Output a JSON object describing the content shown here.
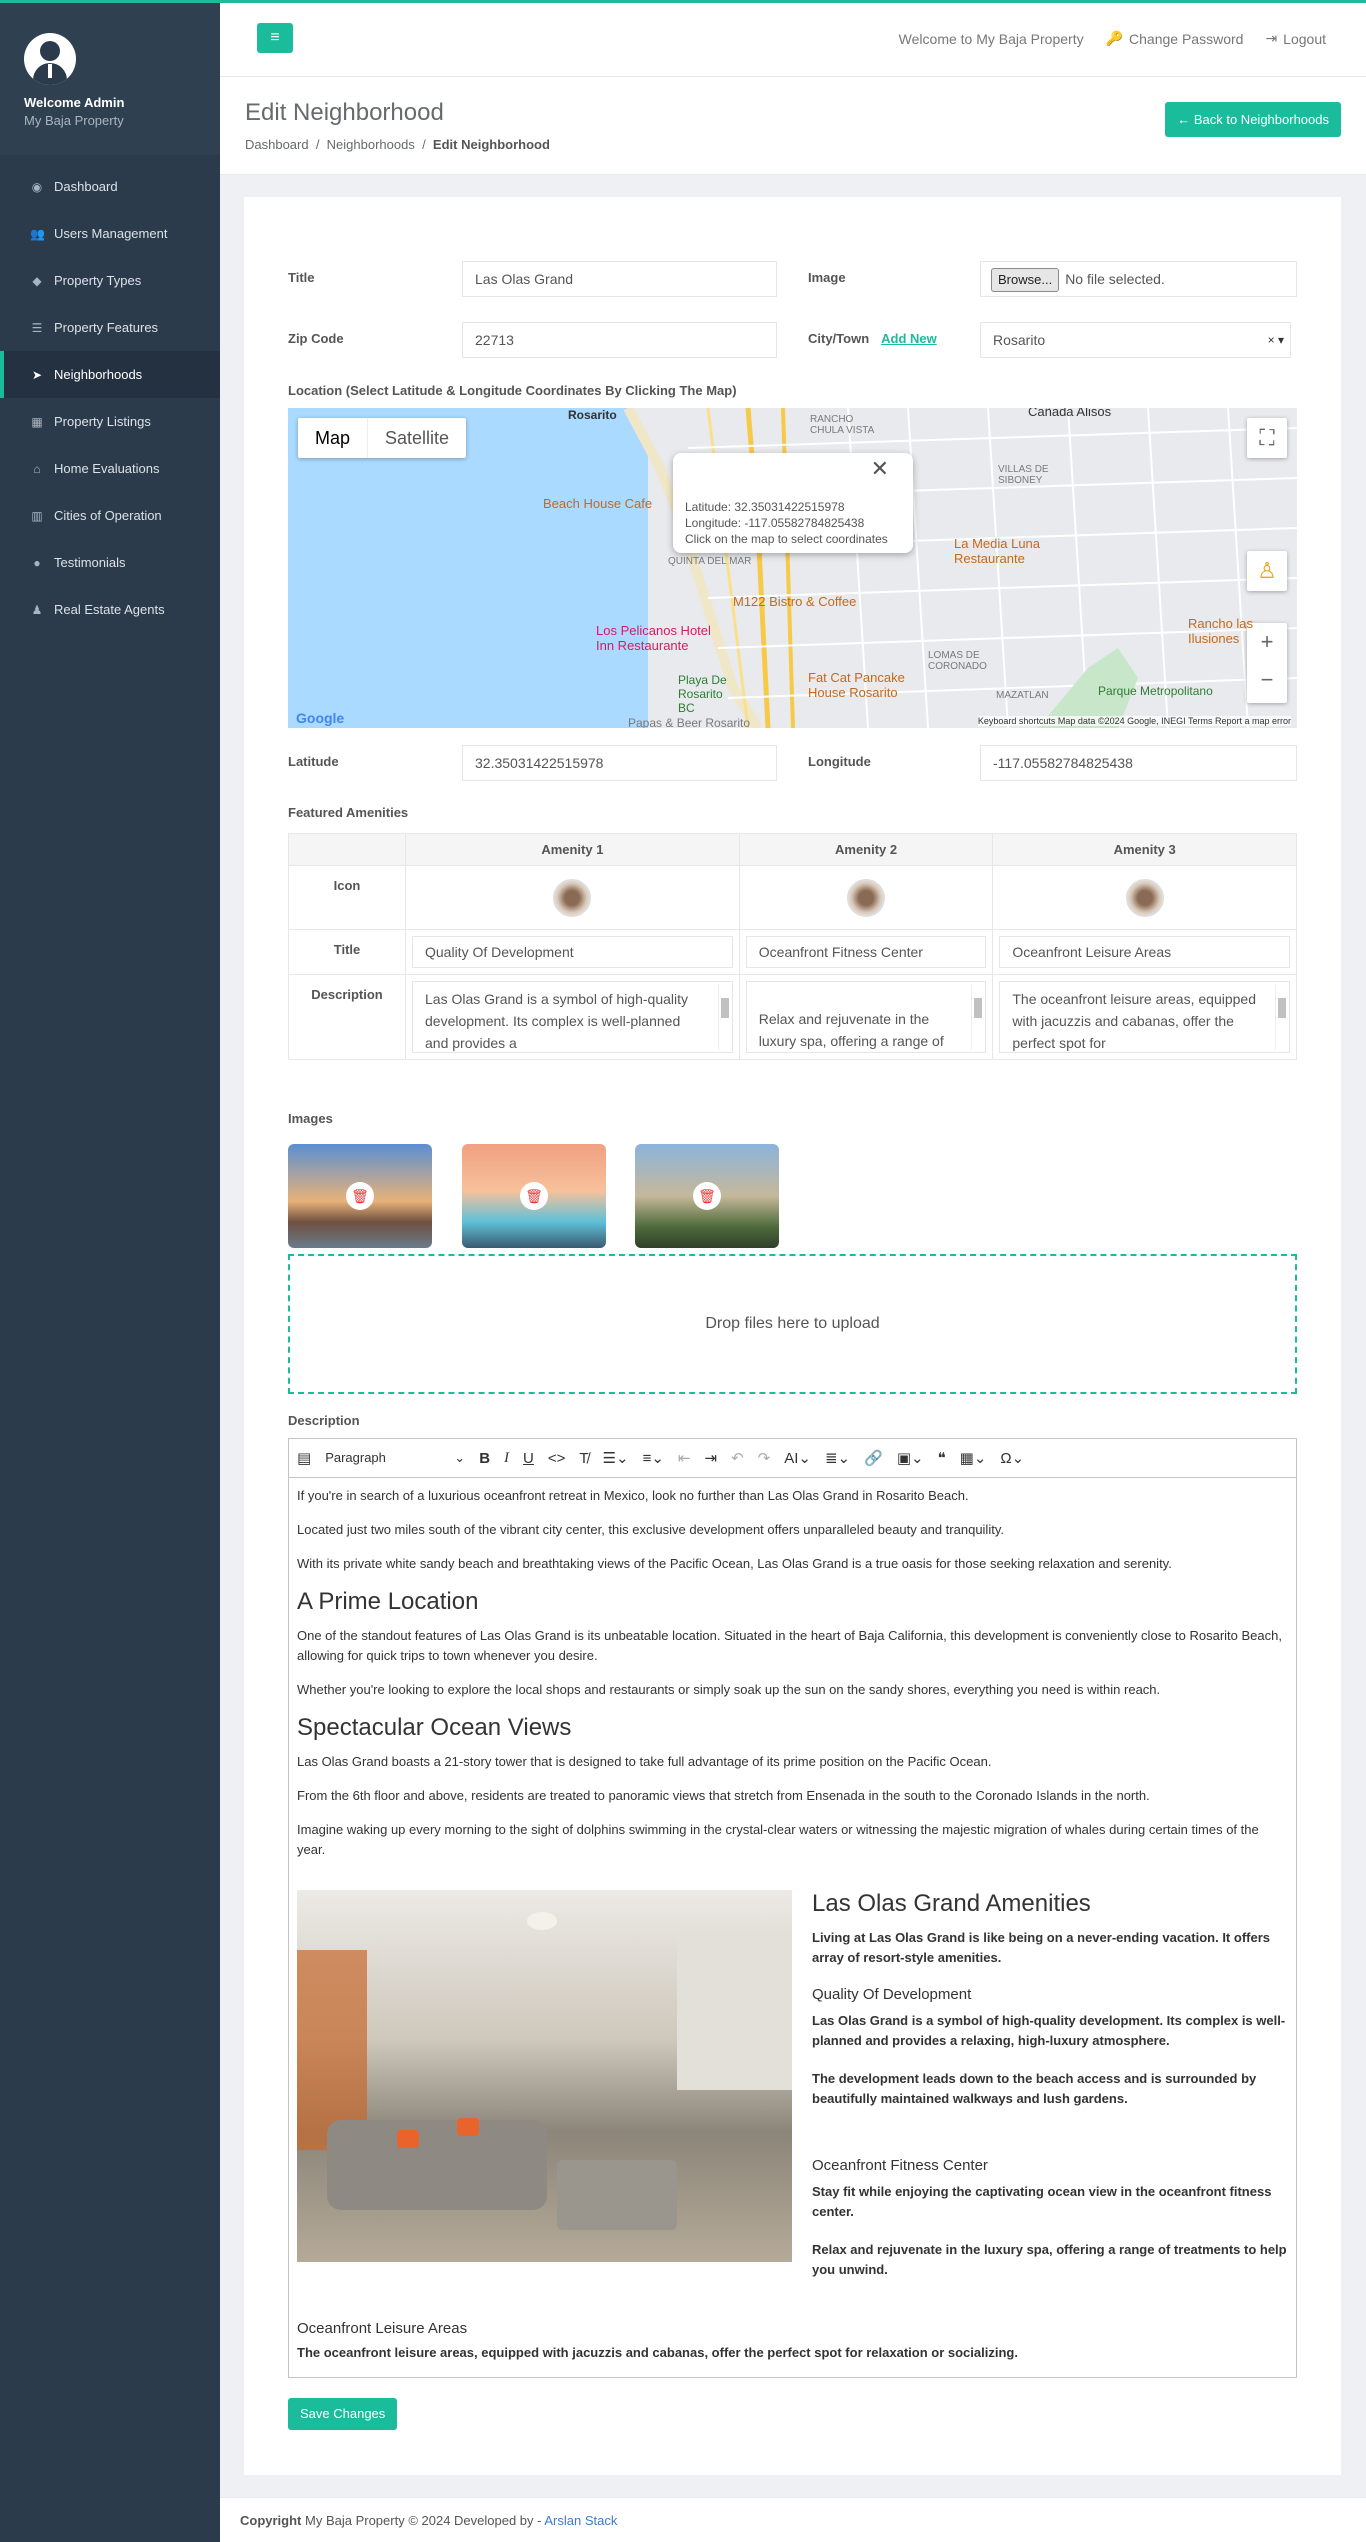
{
  "sidebar": {
    "user_name": "Welcome Admin",
    "user_sub": "My Baja Property",
    "items": [
      {
        "label": "Dashboard",
        "icon": "dashboard-icon"
      },
      {
        "label": "Users Management",
        "icon": "users-icon"
      },
      {
        "label": "Property Types",
        "icon": "tags-icon"
      },
      {
        "label": "Property Features",
        "icon": "list-icon"
      },
      {
        "label": "Neighborhoods",
        "icon": "location-arrow-icon",
        "active": true
      },
      {
        "label": "Property Listings",
        "icon": "table-icon"
      },
      {
        "label": "Home Evaluations",
        "icon": "home-icon"
      },
      {
        "label": "Cities of Operation",
        "icon": "building-icon"
      },
      {
        "label": "Testimonials",
        "icon": "comment-icon"
      },
      {
        "label": "Real Estate Agents",
        "icon": "user-icon"
      }
    ]
  },
  "topbar": {
    "welcome": "Welcome to My Baja Property",
    "change_password": "Change Password",
    "logout": "Logout"
  },
  "header": {
    "title": "Edit Neighborhood",
    "breadcrumb": [
      "Dashboard",
      "Neighborhoods",
      "Edit Neighborhood"
    ],
    "back_label": "Back to Neighborhoods"
  },
  "form": {
    "title_label": "Title",
    "title_value": "Las Olas Grand",
    "image_label": "Image",
    "browse_label": "Browse...",
    "file_status": "No file selected.",
    "zip_label": "Zip Code",
    "zip_value": "22713",
    "city_label": "City/Town",
    "add_new": "Add New",
    "city_value": "Rosarito",
    "location_label": "Location (Select Latitude & Longitude Coordinates By Clicking The Map)",
    "latitude_label": "Latitude",
    "latitude_value": "32.35031422515978",
    "longitude_label": "Longitude",
    "longitude_value": "-117.05582784825438"
  },
  "map": {
    "type_map": "Map",
    "type_satellite": "Satellite",
    "info_lat": "Latitude: 32.35031422515978",
    "info_lng": "Longitude: -117.05582784825438",
    "info_hint": "Click on the map to select coordinates",
    "footer": "Keyboard shortcuts   Map data ©2024 Google, INEGI   Terms   Report a map error",
    "google": "Google",
    "places": {
      "rosarito": "Rosarito",
      "rancho_chula": "RANCHO CHULA VISTA",
      "canada": "Cañada Alisos",
      "villas": "VILLAS DE SIBONEY",
      "beach_house": "Beach House Cafe",
      "quinta": "QUINTA DEL MAR",
      "media_luna": "La Media Luna Restaurante",
      "m122": "M122 Bistro & Coffee",
      "ilusiones": "Rancho las Ilusiones",
      "pelicanos": "Los Pelicanos Hotel Inn Restaurante",
      "lomas": "LOMAS DE CORONADO",
      "playa": "Playa De Rosarito BC",
      "fat_cat": "Fat Cat Pancake House Rosarito",
      "mazatlan": "MAZATLAN",
      "parque": "Parque Metropolitano",
      "papas": "Papas & Beer Rosarito"
    }
  },
  "amenities": {
    "section_label": "Featured Amenities",
    "headers": [
      "Amenity 1",
      "Amenity 2",
      "Amenity 3"
    ],
    "row_icon": "Icon",
    "row_title": "Title",
    "row_desc": "Description",
    "titles": [
      "Quality Of Development",
      "Oceanfront Fitness Center",
      "Oceanfront Leisure Areas"
    ],
    "descriptions": [
      "Las Olas Grand is a symbol of high-quality development. Its complex is well-planned and provides a",
      "Relax and rejuvenate in the luxury spa, offering a range of treatments",
      "The oceanfront leisure areas, equipped with jacuzzis and cabanas, offer the perfect spot for"
    ]
  },
  "images": {
    "label": "Images",
    "dropzone": "Drop files here to upload"
  },
  "description": {
    "label": "Description",
    "paragraph_select": "Paragraph",
    "p1": "If you're in search of a luxurious oceanfront retreat in Mexico, look no further than Las Olas Grand in Rosarito Beach.",
    "p2": "Located just two miles south of the vibrant city center, this exclusive development offers unparalleled beauty and tranquility.",
    "p3": "With its private white sandy beach and breathtaking views of the Pacific Ocean, Las Olas Grand is a true oasis for those seeking relaxation and serenity.",
    "h_prime": "A Prime Location",
    "p4": "One of the standout features of Las Olas Grand is its unbeatable location. Situated in the heart of Baja California, this development is conveniently close to Rosarito Beach, allowing for quick trips to town whenever you desire.",
    "p5": "Whether you're looking to explore the local shops and restaurants or simply soak up the sun on the sandy shores, everything you need is within reach.",
    "h_ocean": "Spectacular Ocean Views",
    "p6": "Las Olas Grand boasts a 21-story tower that is designed to take full advantage of its prime position on the Pacific Ocean.",
    "p7": "From the 6th floor and above, residents are treated to panoramic views that stretch from Ensenada in the south to the Coronado Islands in the north.",
    "p8": "Imagine waking up every morning to the sight of dolphins swimming in the crystal-clear waters or witnessing the majestic migration of whales during certain times of the year.",
    "h_amen": "Las Olas Grand Amenities",
    "amen_intro": "Living at Las Olas Grand is like being on a never-ending vacation. It offers array of resort-style amenities.",
    "a1_title": "Quality Of Development",
    "a1_p1": "Las Olas Grand is a symbol of high-quality development. Its complex is well-planned and provides a relaxing, high-luxury atmosphere.",
    "a1_p2": "The development leads down to the beach access and is surrounded by beautifully maintained walkways and lush gardens.",
    "a2_title": "Oceanfront Fitness Center",
    "a2_p1": "Stay fit while enjoying the captivating ocean view in the oceanfront fitness center.",
    "a2_p2": "Relax and rejuvenate in the luxury spa, offering a range of treatments to help you unwind.",
    "a3_title": "Oceanfront Leisure Areas",
    "a3_p1": "The oceanfront leisure areas, equipped with jacuzzis and cabanas, offer the perfect spot for relaxation or socializing."
  },
  "save_label": "Save Changes",
  "footer": {
    "copyright": "Copyright",
    "text": " My Baja Property © 2024 Developed by - ",
    "author": "Arslan Stack"
  }
}
